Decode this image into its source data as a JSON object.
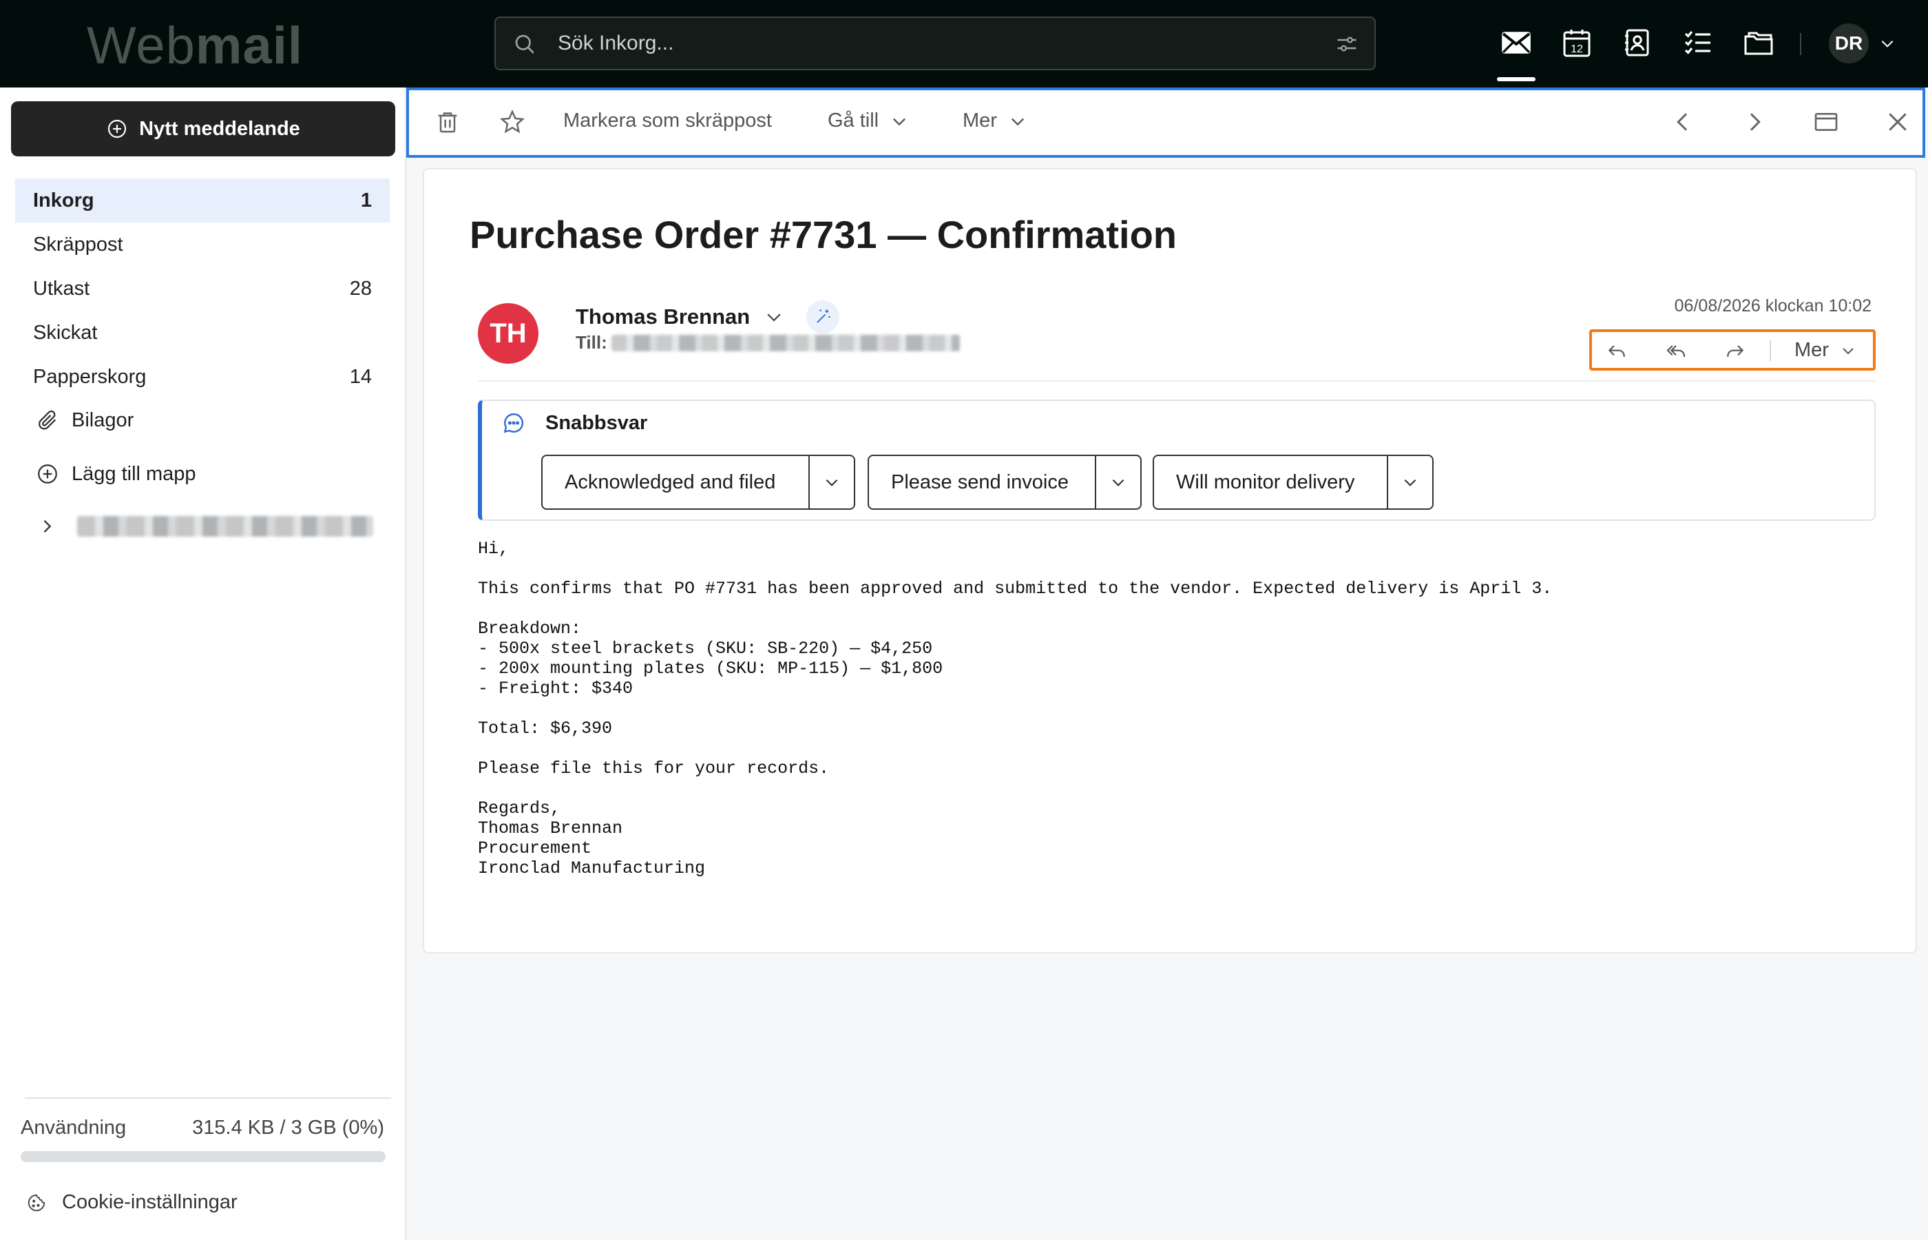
{
  "app": {
    "logo_light": "Web",
    "logo_bold": "mail"
  },
  "search": {
    "placeholder": "Sök Inkorg..."
  },
  "topnav": {
    "icons": [
      "mail-icon",
      "calendar-icon",
      "contacts-icon",
      "tasks-icon",
      "files-icon"
    ],
    "active": "mail-icon",
    "calendar_day": "12",
    "user_initials": "DR"
  },
  "sidebar": {
    "compose_label": "Nytt meddelande",
    "folders": [
      {
        "label": "Inkorg",
        "count": "1",
        "active": true
      },
      {
        "label": "Skräppost",
        "count": ""
      },
      {
        "label": "Utkast",
        "count": "28"
      },
      {
        "label": "Skickat",
        "count": ""
      },
      {
        "label": "Papperskorg",
        "count": "14"
      }
    ],
    "attachments_label": "Bilagor",
    "add_folder_label": "Lägg till mapp",
    "usage_label": "Användning",
    "usage_value": "315.4 KB / 3 GB (0%)",
    "usage_fraction": 0.0,
    "cookie_label": "Cookie-inställningar"
  },
  "toolbar": {
    "spam_label": "Markera som skräppost",
    "goto_label": "Gå till",
    "more_label": "Mer"
  },
  "message": {
    "subject": "Purchase Order #7731 — Confirmation",
    "sender_initials": "TH",
    "sender_name": "Thomas Brennan",
    "to_label": "Till:",
    "date": "06/08/2026 klockan 10:02",
    "more_label": "Mer",
    "quick_reply": {
      "title": "Snabbsvar",
      "options": [
        "Acknowledged and filed",
        "Please send invoice",
        "Will monitor delivery"
      ]
    },
    "body": "Hi,\n\nThis confirms that PO #7731 has been approved and submitted to the vendor. Expected delivery is April 3.\n\nBreakdown:\n- 500x steel brackets (SKU: SB-220) — $4,250\n- 200x mounting plates (SKU: MP-115) — $1,800\n- Freight: $340\n\nTotal: $6,390\n\nPlease file this for your records.\n\nRegards,\nThomas Brennan\nProcurement\nIronclad Manufacturing"
  },
  "colors": {
    "topbar": "#000d0a",
    "accent_blue": "#2b7de1",
    "highlight_orange": "#f07b18",
    "avatar_red": "#e23344",
    "active_folder": "#e7eefc"
  }
}
